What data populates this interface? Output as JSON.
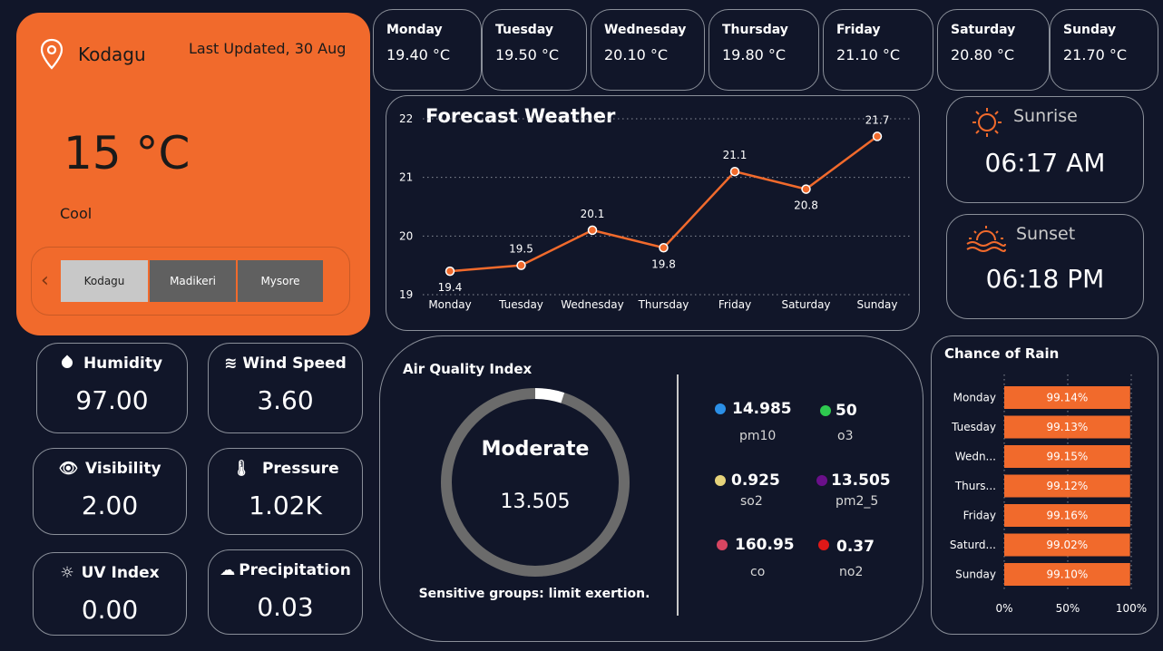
{
  "location": {
    "city": "Kodagu",
    "last_updated": "Last Updated, 30 Aug",
    "temperature": "15 °C",
    "condition": "Cool",
    "tabs": [
      "Kodagu",
      "Madikeri",
      "Mysore"
    ],
    "selected_tab": "Kodagu"
  },
  "days": [
    {
      "name": "Monday",
      "temp": "19.40 °C"
    },
    {
      "name": "Tuesday",
      "temp": "19.50 °C"
    },
    {
      "name": "Wednesday",
      "temp": "20.10 °C"
    },
    {
      "name": "Thursday",
      "temp": "19.80 °C"
    },
    {
      "name": "Friday",
      "temp": "21.10 °C"
    },
    {
      "name": "Saturday",
      "temp": "20.80 °C"
    },
    {
      "name": "Sunday",
      "temp": "21.70 °C"
    }
  ],
  "forecast": {
    "title": "Forecast Weather",
    "chart_data": {
      "type": "line",
      "categories": [
        "Monday",
        "Tuesday",
        "Wednesday",
        "Thursday",
        "Friday",
        "Saturday",
        "Sunday"
      ],
      "values": [
        19.4,
        19.5,
        20.1,
        19.8,
        21.1,
        20.8,
        21.7
      ],
      "data_labels": [
        "19.4",
        "19.5",
        "20.1",
        "19.8",
        "21.1",
        "20.8",
        "21.7"
      ],
      "yticks": [
        "19",
        "20",
        "21",
        "22"
      ],
      "ylim": [
        19,
        22
      ],
      "grid": "dotted horizontal",
      "color": "#f16a2c"
    }
  },
  "sun": {
    "sunrise_label": "Sunrise",
    "sunrise_time": "06:17 AM",
    "sunset_label": "Sunset",
    "sunset_time": "06:18 PM"
  },
  "metrics": {
    "humidity": {
      "label": "Humidity",
      "value": "97.00"
    },
    "wind": {
      "label": "Wind Speed",
      "value": "3.60"
    },
    "visibility": {
      "label": "Visibility",
      "value": "2.00"
    },
    "pressure": {
      "label": "Pressure",
      "value": "1.02K"
    },
    "uv": {
      "label": "UV Index",
      "value": "0.00"
    },
    "precip": {
      "label": "Precipitation",
      "value": "0.03"
    }
  },
  "aqi": {
    "title": "Air Quality Index",
    "status": "Moderate",
    "value": "13.505",
    "advice": "Sensitive groups: limit exertion.",
    "gauge_fraction": 0.05,
    "pollutants": [
      {
        "value": "14.985",
        "name": "pm10",
        "color": "#2b8fe6"
      },
      {
        "value": "50",
        "name": "o3",
        "color": "#2ec94f"
      },
      {
        "value": "0.925",
        "name": "so2",
        "color": "#e6d37a"
      },
      {
        "value": "13.505",
        "name": "pm2_5",
        "color": "#6a0f8a"
      },
      {
        "value": "160.95",
        "name": "co",
        "color": "#d64561"
      },
      {
        "value": "0.37",
        "name": "no2",
        "color": "#e01818"
      }
    ]
  },
  "rain": {
    "title": "Chance of Rain",
    "chart_data": {
      "type": "bar",
      "orientation": "horizontal",
      "categories": [
        "Monday",
        "Tuesday",
        "Wedn...",
        "Thurs...",
        "Friday",
        "Saturd...",
        "Sunday"
      ],
      "values": [
        99.14,
        99.13,
        99.15,
        99.12,
        99.16,
        99.02,
        99.1
      ],
      "data_labels": [
        "99.14%",
        "99.13%",
        "99.15%",
        "99.12%",
        "99.16%",
        "99.02%",
        "99.10%"
      ],
      "xticks": [
        "0%",
        "50%",
        "100%"
      ],
      "xlim": [
        0,
        100
      ],
      "color": "#f16a2c"
    }
  }
}
